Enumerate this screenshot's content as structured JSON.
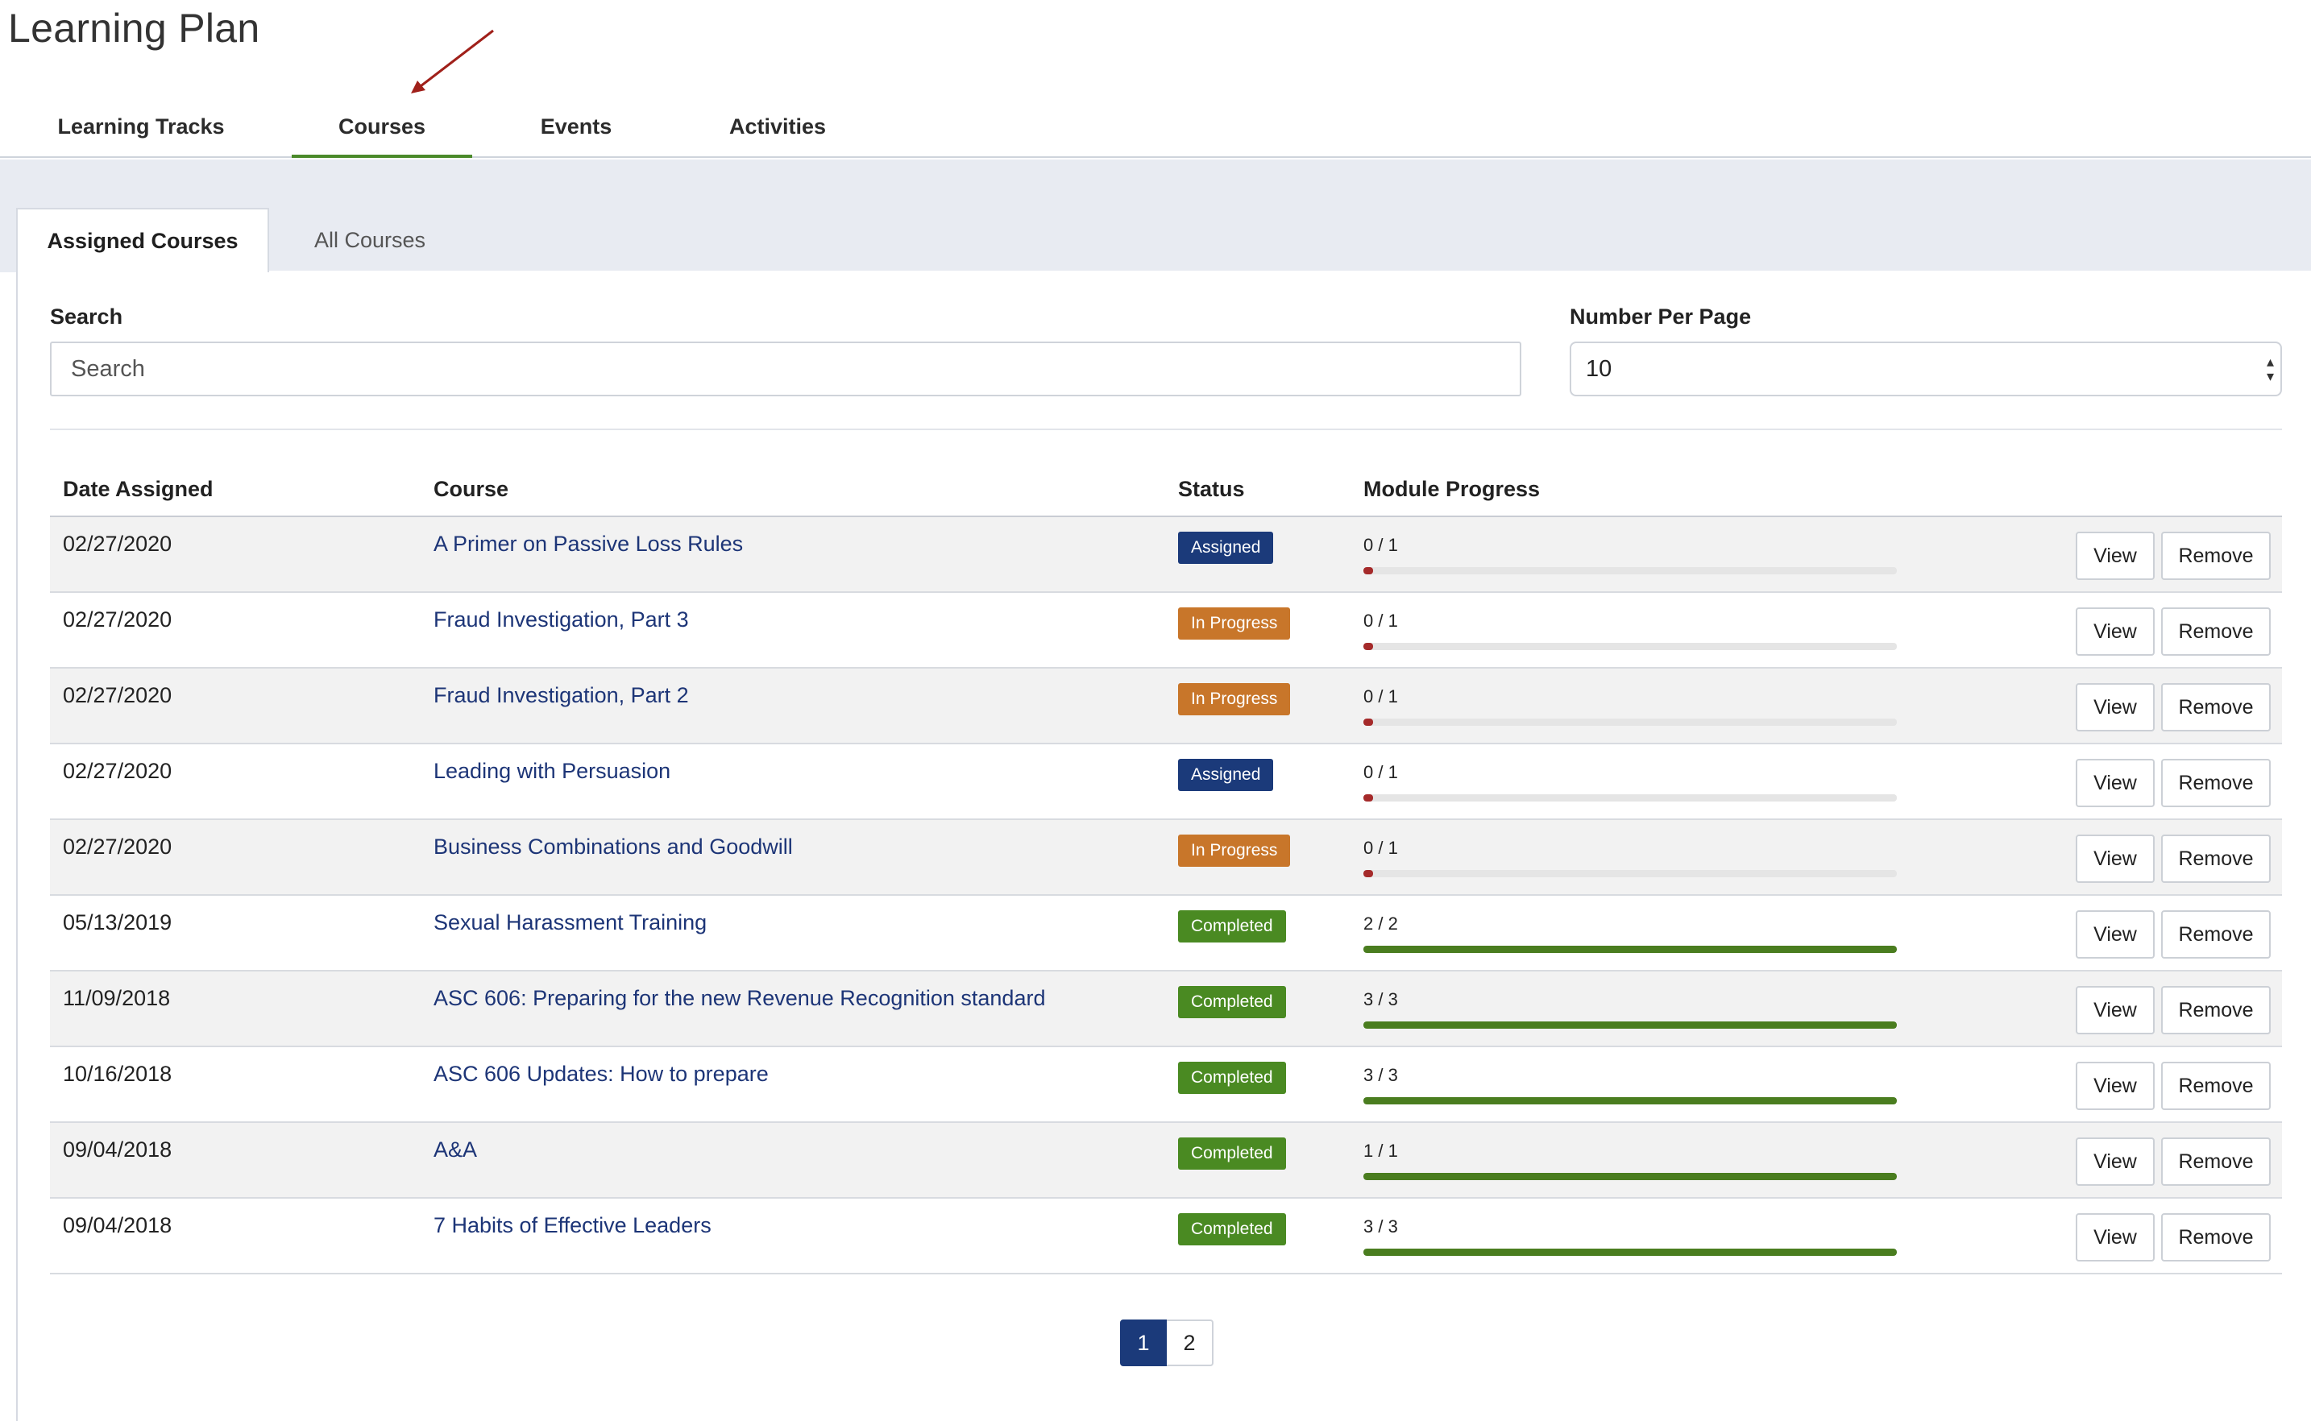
{
  "page": {
    "title": "Learning Plan"
  },
  "top_tabs": [
    {
      "label": "Learning Tracks",
      "active": false
    },
    {
      "label": "Courses",
      "active": true
    },
    {
      "label": "Events",
      "active": false
    },
    {
      "label": "Activities",
      "active": false
    }
  ],
  "sub_tabs": [
    {
      "label": "Assigned Courses",
      "active": true
    },
    {
      "label": "All Courses",
      "active": false
    }
  ],
  "filters": {
    "search_label": "Search",
    "search_placeholder": "Search",
    "per_page_label": "Number Per Page",
    "per_page_value": "10"
  },
  "table": {
    "headers": {
      "date": "Date Assigned",
      "course": "Course",
      "status": "Status",
      "progress": "Module Progress"
    },
    "view_label": "View",
    "remove_label": "Remove",
    "rows": [
      {
        "date": "02/27/2020",
        "course": "A Primer on Passive Loss Rules",
        "status": "Assigned",
        "progress": "0 / 1",
        "fraction": 0
      },
      {
        "date": "02/27/2020",
        "course": "Fraud Investigation, Part 3",
        "status": "In Progress",
        "progress": "0 / 1",
        "fraction": 0
      },
      {
        "date": "02/27/2020",
        "course": "Fraud Investigation, Part 2",
        "status": "In Progress",
        "progress": "0 / 1",
        "fraction": 0
      },
      {
        "date": "02/27/2020",
        "course": "Leading with Persuasion",
        "status": "Assigned",
        "progress": "0 / 1",
        "fraction": 0
      },
      {
        "date": "02/27/2020",
        "course": "Business Combinations and Goodwill",
        "status": "In Progress",
        "progress": "0 / 1",
        "fraction": 0
      },
      {
        "date": "05/13/2019",
        "course": "Sexual Harassment Training",
        "status": "Completed",
        "progress": "2 / 2",
        "fraction": 1
      },
      {
        "date": "11/09/2018",
        "course": "ASC 606: Preparing for the new Revenue Recognition standard",
        "status": "Completed",
        "progress": "3 / 3",
        "fraction": 1
      },
      {
        "date": "10/16/2018",
        "course": "ASC 606 Updates: How to prepare",
        "status": "Completed",
        "progress": "3 / 3",
        "fraction": 1
      },
      {
        "date": "09/04/2018",
        "course": "A&A",
        "status": "Completed",
        "progress": "1 / 1",
        "fraction": 1
      },
      {
        "date": "09/04/2018",
        "course": "7 Habits of Effective Leaders",
        "status": "Completed",
        "progress": "3 / 3",
        "fraction": 1
      }
    ]
  },
  "status_colors": {
    "Assigned": "#1b3a7a",
    "In Progress": "#c8762a",
    "Completed": "#4a8a22"
  },
  "progress_colors": {
    "zero": "#a52a2a",
    "done": "#4a7d1f"
  },
  "pagination": {
    "pages": [
      "1",
      "2"
    ],
    "current": "1"
  },
  "annotation": {
    "icon": "red-arrow-icon",
    "color": "#a0201a"
  }
}
